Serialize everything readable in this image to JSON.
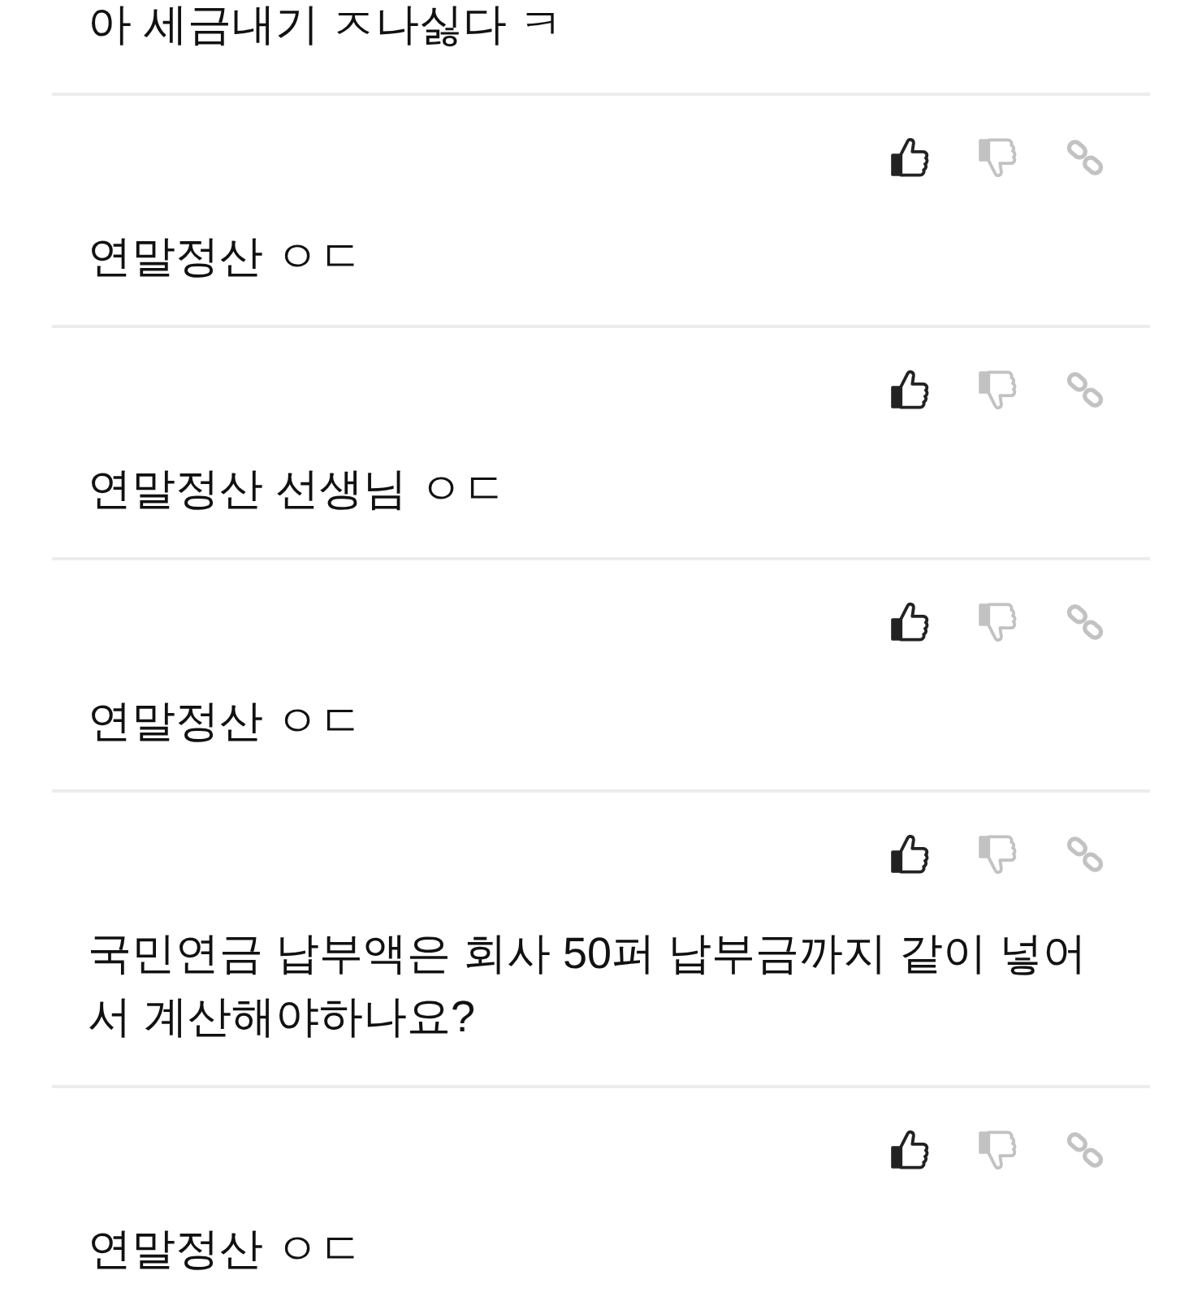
{
  "comments": [
    {
      "kind": "clipped",
      "text": "아 세금내기 ㅈ나싫다 ㅋ"
    },
    {
      "kind": "full",
      "text": "연말정산 ㅇㄷ"
    },
    {
      "kind": "full",
      "text": "연말정산 선생님 ㅇㄷ"
    },
    {
      "kind": "full",
      "text": "연말정산 ㅇㄷ"
    },
    {
      "kind": "full",
      "text": "국민연금 납부액은 회사 50퍼 납부금까지 같이 넣어서 계산해야하나요?"
    },
    {
      "kind": "full",
      "text": "연말정산 ㅇㄷ"
    }
  ]
}
